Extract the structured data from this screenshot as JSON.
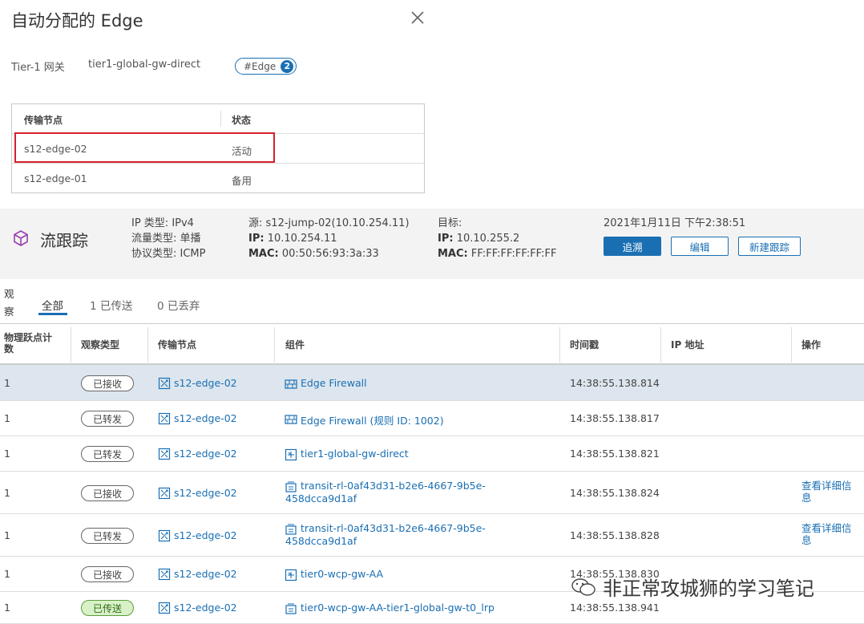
{
  "dialog": {
    "title": "自动分配的 Edge",
    "tier1_label": "Tier-1 网关",
    "tier1_value": "tier1-global-gw-direct",
    "edge_tag": "#Edge",
    "edge_count": "2"
  },
  "transport_nodes": {
    "headers": [
      "传输节点",
      "状态"
    ],
    "rows": [
      {
        "node": "s12-edge-02",
        "status": "活动"
      },
      {
        "node": "s12-edge-01",
        "status": "备用"
      }
    ]
  },
  "flow_trace": {
    "title": "流跟踪",
    "ip_type": "IP 类型: IPv4",
    "traffic_type": "流量类型: 单播",
    "protocol_type": "协议类型: ICMP",
    "source_label": "源:",
    "source_value": "s12-jump-02(10.10.254.11)",
    "source_ip_label": "IP:",
    "source_ip_value": "10.10.254.11",
    "source_mac_label": "MAC:",
    "source_mac_value": "00:50:56:93:3a:33",
    "target_label": "目标:",
    "target_ip_label": "IP:",
    "target_ip_value": "10.10.255.2",
    "target_mac_label": "MAC:",
    "target_mac_value": "FF:FF:FF:FF:FF:FF",
    "timestamp": "2021年1月11日 下午2:38:51",
    "buttons": {
      "trace": "追溯",
      "edit": "编辑",
      "new_trace": "新建跟踪"
    }
  },
  "observations": {
    "label_line1": "观",
    "label_line2": "察",
    "tabs": [
      "全部",
      "1 已传送",
      "0 已丢弃"
    ],
    "headers": [
      "物理跃点计数",
      "观察类型",
      "传输节点",
      "组件",
      "时间戳",
      "IP 地址",
      "操作"
    ],
    "rows": [
      {
        "hop": "1",
        "type": "已接收",
        "node": "s12-edge-02",
        "component": "Edge Firewall",
        "component2": "",
        "icon": "firewall-icon",
        "time": "14:38:55.138.814",
        "ip": "",
        "action": "",
        "action2": ""
      },
      {
        "hop": "1",
        "type": "已转发",
        "node": "s12-edge-02",
        "component": "Edge Firewall (规则 ID: 1002)",
        "component2": "",
        "icon": "firewall-icon",
        "time": "14:38:55.138.817",
        "ip": "",
        "action": "",
        "action2": ""
      },
      {
        "hop": "1",
        "type": "已转发",
        "node": "s12-edge-02",
        "component": "tier1-global-gw-direct",
        "component2": "",
        "icon": "router-icon",
        "time": "14:38:55.138.821",
        "ip": "",
        "action": "",
        "action2": ""
      },
      {
        "hop": "1",
        "type": "已接收",
        "node": "s12-edge-02",
        "component": "transit-rl-0af43d31-b2e6-4667-9b5e-",
        "component2": "458dcca9d1af",
        "icon": "port-icon",
        "time": "14:38:55.138.824",
        "ip": "",
        "action": "查看详细信",
        "action2": "息"
      },
      {
        "hop": "1",
        "type": "已转发",
        "node": "s12-edge-02",
        "component": "transit-rl-0af43d31-b2e6-4667-9b5e-",
        "component2": "458dcca9d1af",
        "icon": "port-icon",
        "time": "14:38:55.138.828",
        "ip": "",
        "action": "查看详细信",
        "action2": "息"
      },
      {
        "hop": "1",
        "type": "已接收",
        "node": "s12-edge-02",
        "component": "tier0-wcp-gw-AA",
        "component2": "",
        "icon": "router-icon",
        "time": "14:38:55.138.830",
        "ip": "",
        "action": "",
        "action2": ""
      },
      {
        "hop": "1",
        "type": "已传送",
        "node": "s12-edge-02",
        "component": "tier0-wcp-gw-AA-tier1-global-gw-t0_lrp",
        "component2": "",
        "icon": "port-icon",
        "time": "14:38:55.138.941",
        "ip": "",
        "action": "",
        "action2": ""
      }
    ]
  },
  "watermark": "非正常攻城狮的学习笔记",
  "colors": {
    "accent": "#1a6fb3",
    "highlight": "#d6202a",
    "selected_row": "#dde6ee",
    "delivered_pill": "#d9f1c9"
  }
}
